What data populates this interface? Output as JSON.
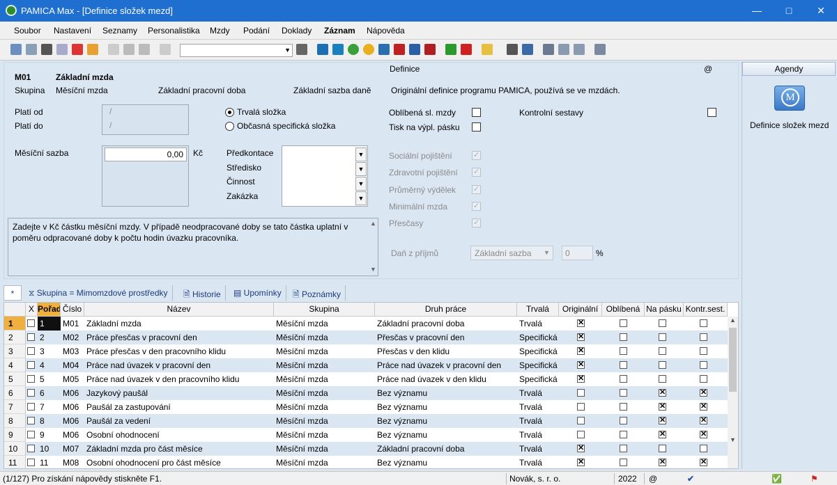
{
  "window": {
    "title": "PAMICA Max - [Definice složek mezd]"
  },
  "menu": [
    "Soubor",
    "Nastavení",
    "Seznamy",
    "Personalistika",
    "Mzdy",
    "Podání",
    "Doklady",
    "Záznam",
    "Nápověda"
  ],
  "detail": {
    "code": "M01",
    "name": "Základní mzda",
    "group_label": "Skupina",
    "group_value": "Měsíční mzda",
    "worktype_value": "Základní pracovní doba",
    "tax_value": "Základní sazba daně",
    "valid_from_label": "Platí od",
    "valid_to_label": "Platí do",
    "date_placeholder": "/",
    "radio_permanent": "Trvalá složka",
    "radio_occasional": "Občasná specifická složka",
    "monthly_rate_label": "Měsíční sazba",
    "monthly_rate_value": "0,00",
    "currency": "Kč",
    "predkontace": "Předkontace",
    "stredisko": "Středisko",
    "cinnost": "Činnost",
    "zakazka": "Zakázka",
    "hint": "Zadejte v Kč částku měsíční mzdy. V případě neodpracované doby se tato částka uplatní v poměru odpracované doby k počtu hodin úvazku pracovníka.",
    "definice_label": "Definice",
    "at": "@",
    "definice_text": "Originální definice programu PAMICA, používá se ve mzdách.",
    "favorite": "Oblíbená sl. mzdy",
    "print": "Tisk na výpl. pásku",
    "control": "Kontrolní sestavy",
    "disabled": [
      "Sociální pojištění",
      "Zdravotní pojištění",
      "Průměrný výdělek",
      "Minimální mzda",
      "Přesčasy"
    ],
    "tax_label": "Daň z příjmů",
    "tax_combo": "Základní sazba",
    "tax_pct": "0",
    "pct": "%"
  },
  "agendy": {
    "header": "Agendy",
    "item": "Definice složek mezd",
    "icon_letter": "M"
  },
  "tabs": {
    "star": "*",
    "filter": "Skupina = Mimomzdové prostředky",
    "history": "Historie",
    "reminders": "Upomínky",
    "notes": "Poznámky"
  },
  "grid": {
    "headers": [
      "X",
      "Pořadí",
      "Číslo",
      "Název",
      "Skupina",
      "Druh práce",
      "Trvalá",
      "Originální",
      "Oblíbená",
      "Na pásku",
      "Kontr.sest."
    ],
    "rows": [
      {
        "n": "1",
        "ord": "1",
        "code": "M01",
        "name": "Základní mzda",
        "group": "Měsíční mzda",
        "work": "Základní pracovní doba",
        "perm": "Trvalá",
        "orig": true,
        "fav": false,
        "pay": false,
        "ctrl": false
      },
      {
        "n": "2",
        "ord": "2",
        "code": "M02",
        "name": "Práce přesčas v pracovní den",
        "group": "Měsíční mzda",
        "work": "Přesčas v pracovní den",
        "perm": "Specifická",
        "orig": true,
        "fav": false,
        "pay": false,
        "ctrl": false
      },
      {
        "n": "3",
        "ord": "3",
        "code": "M03",
        "name": "Práce přesčas v den pracovního klidu",
        "group": "Měsíční mzda",
        "work": "Přesčas v den klidu",
        "perm": "Specifická",
        "orig": true,
        "fav": false,
        "pay": false,
        "ctrl": false
      },
      {
        "n": "4",
        "ord": "4",
        "code": "M04",
        "name": "Práce nad úvazek v pracovní den",
        "group": "Měsíční mzda",
        "work": "Práce nad úvazek v pracovní den",
        "perm": "Specifická",
        "orig": true,
        "fav": false,
        "pay": false,
        "ctrl": false
      },
      {
        "n": "5",
        "ord": "5",
        "code": "M05",
        "name": "Práce nad úvazek v den pracovního klidu",
        "group": "Měsíční mzda",
        "work": "Práce nad úvazek v den klidu",
        "perm": "Specifická",
        "orig": true,
        "fav": false,
        "pay": false,
        "ctrl": false
      },
      {
        "n": "6",
        "ord": "6",
        "code": "M06",
        "name": "Jazykový paušál",
        "group": "Měsíční mzda",
        "work": "Bez významu",
        "perm": "Trvalá",
        "orig": false,
        "fav": false,
        "pay": true,
        "ctrl": true
      },
      {
        "n": "7",
        "ord": "7",
        "code": "M06",
        "name": "Paušál za zastupování",
        "group": "Měsíční mzda",
        "work": "Bez významu",
        "perm": "Trvalá",
        "orig": false,
        "fav": false,
        "pay": true,
        "ctrl": true
      },
      {
        "n": "8",
        "ord": "8",
        "code": "M06",
        "name": "Paušál za vedení",
        "group": "Měsíční mzda",
        "work": "Bez významu",
        "perm": "Trvalá",
        "orig": false,
        "fav": false,
        "pay": true,
        "ctrl": true
      },
      {
        "n": "9",
        "ord": "9",
        "code": "M06",
        "name": "Osobní ohodnocení",
        "group": "Měsíční mzda",
        "work": "Bez významu",
        "perm": "Trvalá",
        "orig": false,
        "fav": false,
        "pay": true,
        "ctrl": true
      },
      {
        "n": "10",
        "ord": "10",
        "code": "M07",
        "name": "Základní mzda pro část měsíce",
        "group": "Měsíční mzda",
        "work": "Základní pracovní doba",
        "perm": "Trvalá",
        "orig": true,
        "fav": false,
        "pay": false,
        "ctrl": false
      },
      {
        "n": "11",
        "ord": "11",
        "code": "M08",
        "name": "Osobní ohodnocení pro část měsíce",
        "group": "Měsíční mzda",
        "work": "Bez významu",
        "perm": "Trvalá",
        "orig": true,
        "fav": false,
        "pay": true,
        "ctrl": true
      }
    ]
  },
  "status": {
    "text": "(1/127) Pro získání nápovědy stiskněte F1.",
    "company": "Novák, s. r. o.",
    "year": "2022",
    "at": "@"
  }
}
